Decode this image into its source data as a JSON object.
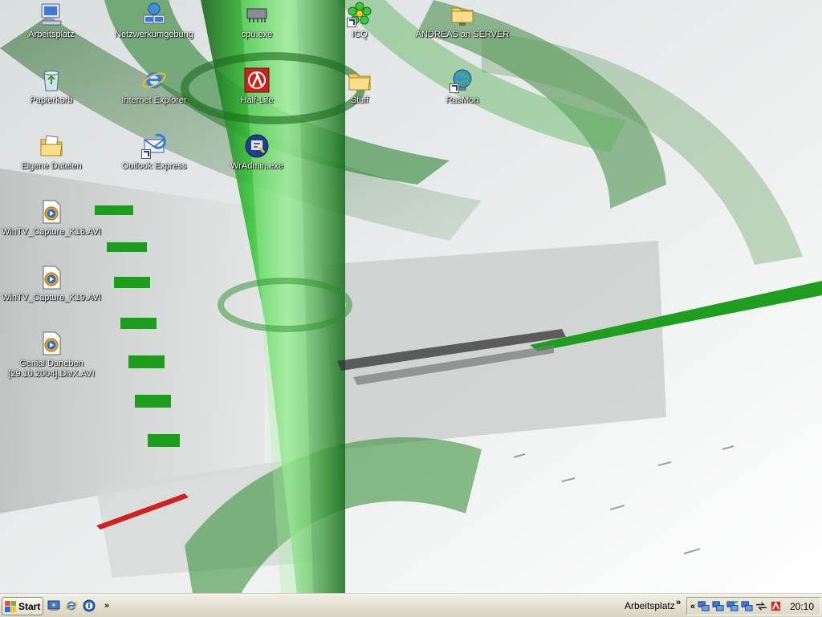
{
  "desktop": {
    "icons": [
      {
        "label": "Arbeitsplatz",
        "icon": "my-computer-icon",
        "shortcut": false
      },
      {
        "label": "Netzwerkumgebung",
        "icon": "network-places-icon",
        "shortcut": false
      },
      {
        "label": "cpu.exe",
        "icon": "cpu-chip-icon",
        "shortcut": false
      },
      {
        "label": "ICQ",
        "icon": "icq-flower-icon",
        "shortcut": true
      },
      {
        "label": "ANDREAS an SERVER",
        "icon": "network-folder-icon",
        "shortcut": false
      },
      {
        "label": "Papierkorb",
        "icon": "recycle-bin-icon",
        "shortcut": false
      },
      {
        "label": "Internet Explorer",
        "icon": "internet-explorer-icon",
        "shortcut": false
      },
      {
        "label": "Half-Life",
        "icon": "half-life-icon",
        "shortcut": false
      },
      {
        "label": "Stuff",
        "icon": "folder-icon",
        "shortcut": false
      },
      {
        "label": "RasMon",
        "icon": "rasmon-globe-icon",
        "shortcut": true
      },
      {
        "label": "Eigene Dateien",
        "icon": "my-documents-icon",
        "shortcut": false
      },
      {
        "label": "Outlook Express",
        "icon": "outlook-express-icon",
        "shortcut": true
      },
      {
        "label": "WrAdmin.exe",
        "icon": "wradmin-icon",
        "shortcut": false
      },
      {
        "label": "WinTV_Capture_K16.AVI",
        "icon": "media-file-icon",
        "shortcut": false
      },
      {
        "label": "WinTV_Capture_K19.AVI",
        "icon": "media-file-icon",
        "shortcut": false
      },
      {
        "label": "Genial Daneben [29.10.2004].DivX.AVI",
        "icon": "media-file-icon",
        "shortcut": false
      }
    ]
  },
  "taskbar": {
    "start_label": "Start",
    "quicklaunch": [
      "show-desktop-icon",
      "internet-explorer-icon",
      "info-icon"
    ],
    "quicklaunch_more": "»",
    "toolbar_label": "Arbeitsplatz",
    "toolbar_more": "»",
    "tray_expand": "«",
    "tray_icons": [
      "network-icon",
      "network-icon",
      "network-activity-icon",
      "network-icon",
      "connection-arrows-icon",
      "antivirus-icon"
    ],
    "clock": "20:10"
  },
  "colors": {
    "taskbar_bg": "#e2dfd0",
    "wallpaper_green": "#2aa52a",
    "wallpaper_bg": "#e9ecec"
  }
}
